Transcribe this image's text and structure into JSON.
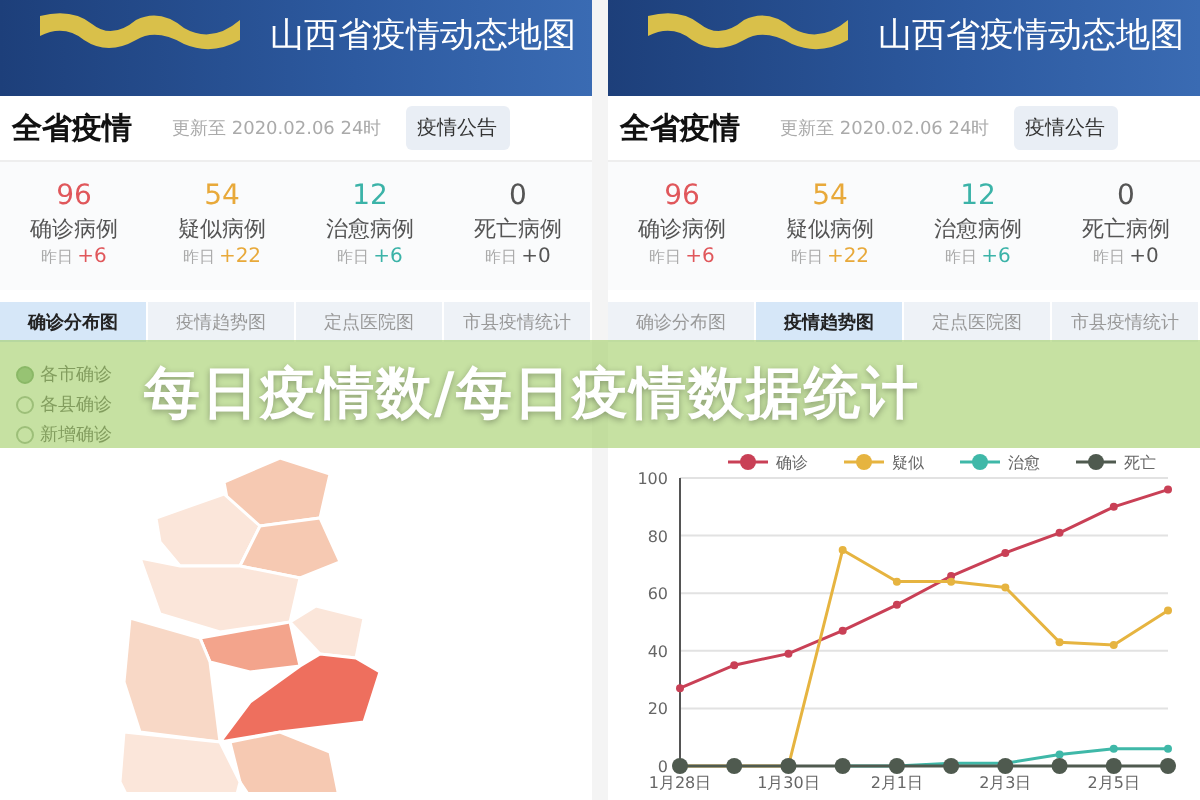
{
  "panels": [
    {
      "header": {
        "title": "山西省疫情动态地图"
      },
      "summary": {
        "title": "全省疫情",
        "updated": "更新至 2020.02.06 24时",
        "button": "疫情公告"
      },
      "stats": [
        {
          "value": "96",
          "label": "确诊病例",
          "delta_label": "昨日",
          "delta": "+6",
          "color": "#e0575b"
        },
        {
          "value": "54",
          "label": "疑似病例",
          "delta_label": "昨日",
          "delta": "+22",
          "color": "#e8a93a"
        },
        {
          "value": "12",
          "label": "治愈病例",
          "delta_label": "昨日",
          "delta": "+6",
          "color": "#3bb3a8"
        },
        {
          "value": "0",
          "label": "死亡病例",
          "delta_label": "昨日",
          "delta": "+0",
          "color": "#555555"
        }
      ],
      "tabs": [
        {
          "label": "确诊分布图",
          "selected": true
        },
        {
          "label": "疫情趋势图",
          "selected": false
        },
        {
          "label": "定点医院图",
          "selected": false
        },
        {
          "label": "市县疫情统计",
          "selected": false
        }
      ],
      "content": {
        "kind": "map",
        "options": [
          {
            "label": "各市确诊",
            "selected": true
          },
          {
            "label": "各县确诊",
            "selected": false
          },
          {
            "label": "新增确诊",
            "selected": false
          }
        ]
      }
    },
    {
      "header": {
        "title": "山西省疫情动态地图"
      },
      "summary": {
        "title": "全省疫情",
        "updated": "更新至 2020.02.06 24时",
        "button": "疫情公告"
      },
      "stats": [
        {
          "value": "96",
          "label": "确诊病例",
          "delta_label": "昨日",
          "delta": "+6",
          "color": "#e0575b"
        },
        {
          "value": "54",
          "label": "疑似病例",
          "delta_label": "昨日",
          "delta": "+22",
          "color": "#e8a93a"
        },
        {
          "value": "12",
          "label": "治愈病例",
          "delta_label": "昨日",
          "delta": "+6",
          "color": "#3bb3a8"
        },
        {
          "value": "0",
          "label": "死亡病例",
          "delta_label": "昨日",
          "delta": "+0",
          "color": "#555555"
        }
      ],
      "tabs": [
        {
          "label": "确诊分布图",
          "selected": false
        },
        {
          "label": "疫情趋势图",
          "selected": true
        },
        {
          "label": "定点医院图",
          "selected": false
        },
        {
          "label": "市县疫情统计",
          "selected": false
        }
      ],
      "content": {
        "kind": "chart",
        "chart_data": {
          "type": "line",
          "categories": [
            "1月28日",
            null,
            "1月30日",
            null,
            "2月1日",
            null,
            "2月3日",
            null,
            "2月5日",
            null
          ],
          "ylim": [
            0,
            100
          ],
          "yticks": [
            0,
            20,
            40,
            60,
            80,
            100
          ],
          "grid": true,
          "legend": true,
          "series": [
            {
              "name": "确诊",
              "color": "#c94056",
              "marker": "circle",
              "values": [
                27,
                35,
                39,
                47,
                56,
                66,
                74,
                81,
                90,
                96
              ]
            },
            {
              "name": "疑似",
              "color": "#e6b440",
              "marker": "circle",
              "values": [
                0,
                0,
                0,
                75,
                64,
                64,
                62,
                43,
                42,
                54
              ]
            },
            {
              "name": "治愈",
              "color": "#3fb8a8",
              "marker": "circle",
              "values": [
                null,
                null,
                null,
                0,
                0,
                1,
                1,
                4,
                6,
                6
              ]
            },
            {
              "name": "死亡",
              "color": "#4f5a4f",
              "marker": "circle",
              "values": [
                0,
                0,
                0,
                0,
                0,
                0,
                0,
                0,
                0,
                0
              ]
            }
          ]
        }
      }
    }
  ],
  "overlay_title": "每日疫情数/每日疫情数据统计"
}
